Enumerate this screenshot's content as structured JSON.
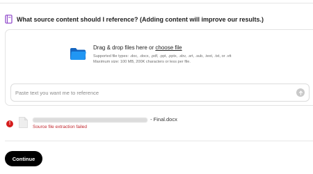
{
  "question": {
    "icon": "book-icon",
    "text": "What source content should I reference? (Adding content will improve our results.)"
  },
  "upload": {
    "icon": "folder-icon",
    "title_prefix": "Drag & drop files here or ",
    "choose_link": "choose file",
    "supported_types": "Supported file types: .doc, .docx, .pdf, .ppt, .pptx, .sbv, .srt, .sub, .text, .txt, or .vtt",
    "max_size": "Maximum size: 100 MB, 200K characters or less per file.",
    "accent_color": "#1e88e5"
  },
  "text_reference": {
    "placeholder": "Paste text you want me to reference",
    "value": "",
    "send_icon": "arrow-up-icon"
  },
  "attached_file": {
    "status_icon": "error-icon",
    "file_icon": "document-icon",
    "name_suffix": " - Final.docx",
    "error_message": "Source file extraction failed",
    "error_color": "#d51c1c"
  },
  "actions": {
    "continue_label": "Continue"
  }
}
